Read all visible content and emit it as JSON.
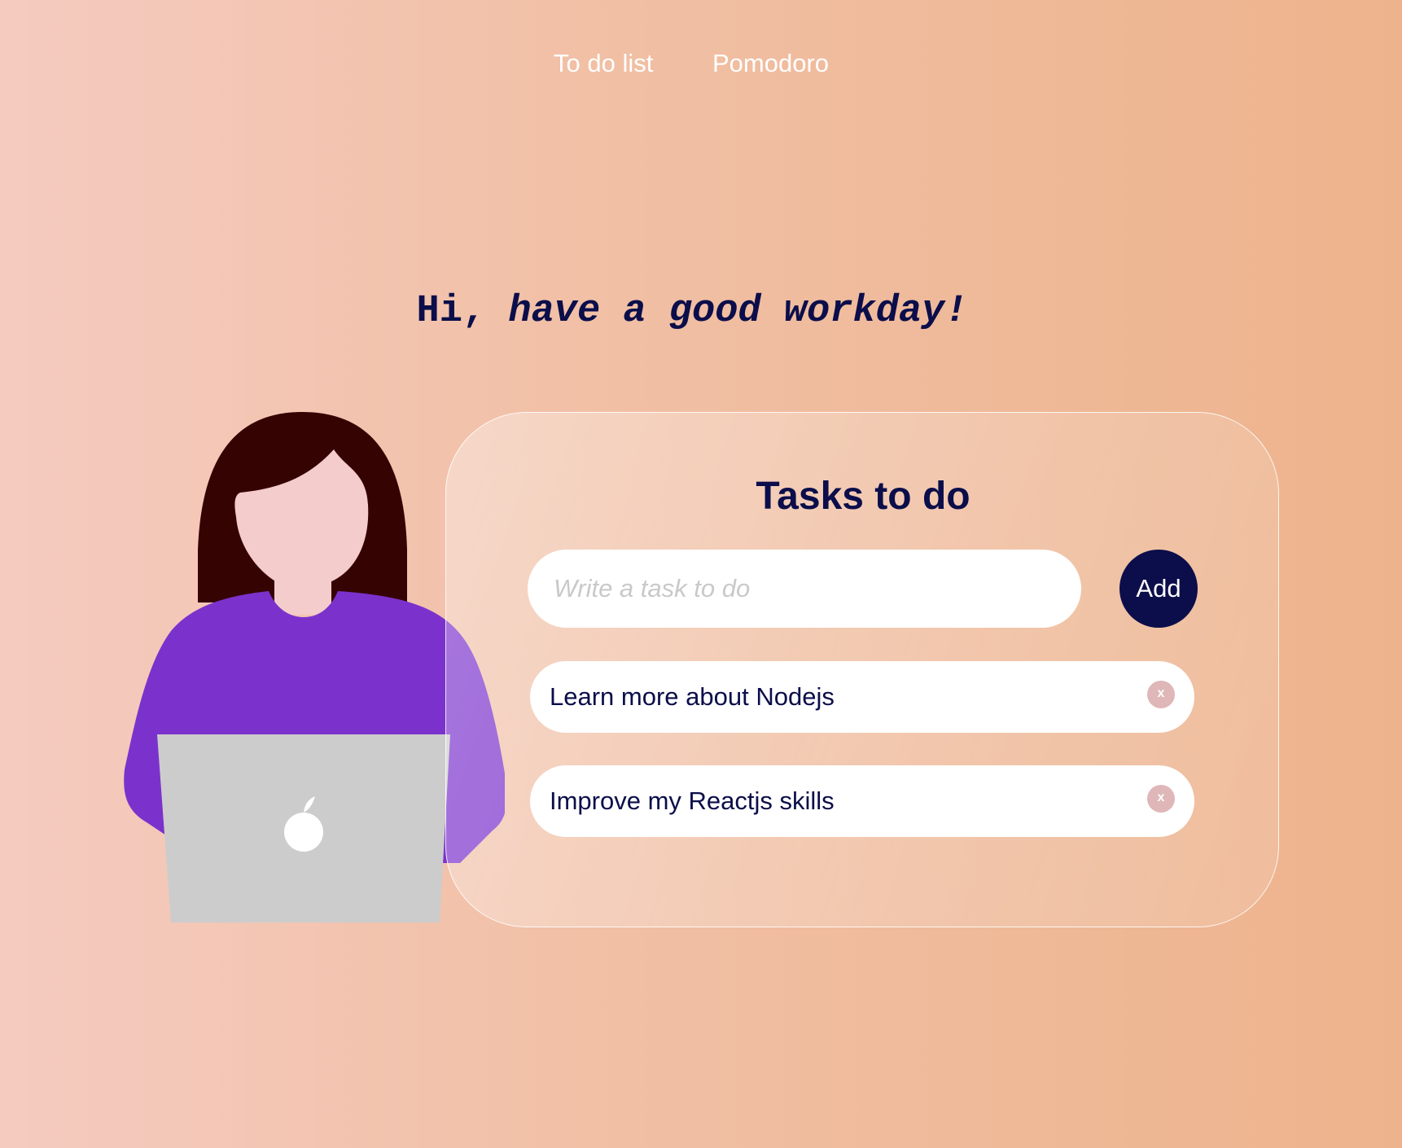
{
  "nav": {
    "items": [
      {
        "label": "To do list"
      },
      {
        "label": "Pomodoro"
      }
    ]
  },
  "greeting": {
    "hi": "Hi,",
    "rest": "have a good workday!"
  },
  "card": {
    "title": "Tasks to do",
    "input": {
      "placeholder": "Write a task to do",
      "value": ""
    },
    "add_label": "Add",
    "tasks": [
      {
        "text": "Learn more about Nodejs",
        "delete_label": "x"
      },
      {
        "text": "Improve my Reactjs skills",
        "delete_label": "x"
      }
    ]
  },
  "colors": {
    "background_start": "#f5cbc0",
    "background_end": "#edb38c",
    "text_dark": "#0b0e4a",
    "hair": "#360303",
    "skin": "#f4cccc",
    "shirt": "#7b32cc",
    "laptop": "#cccccc",
    "delete_button": "#dfb7b8"
  },
  "icons": {
    "laptop_logo": "apple-logo-icon"
  }
}
